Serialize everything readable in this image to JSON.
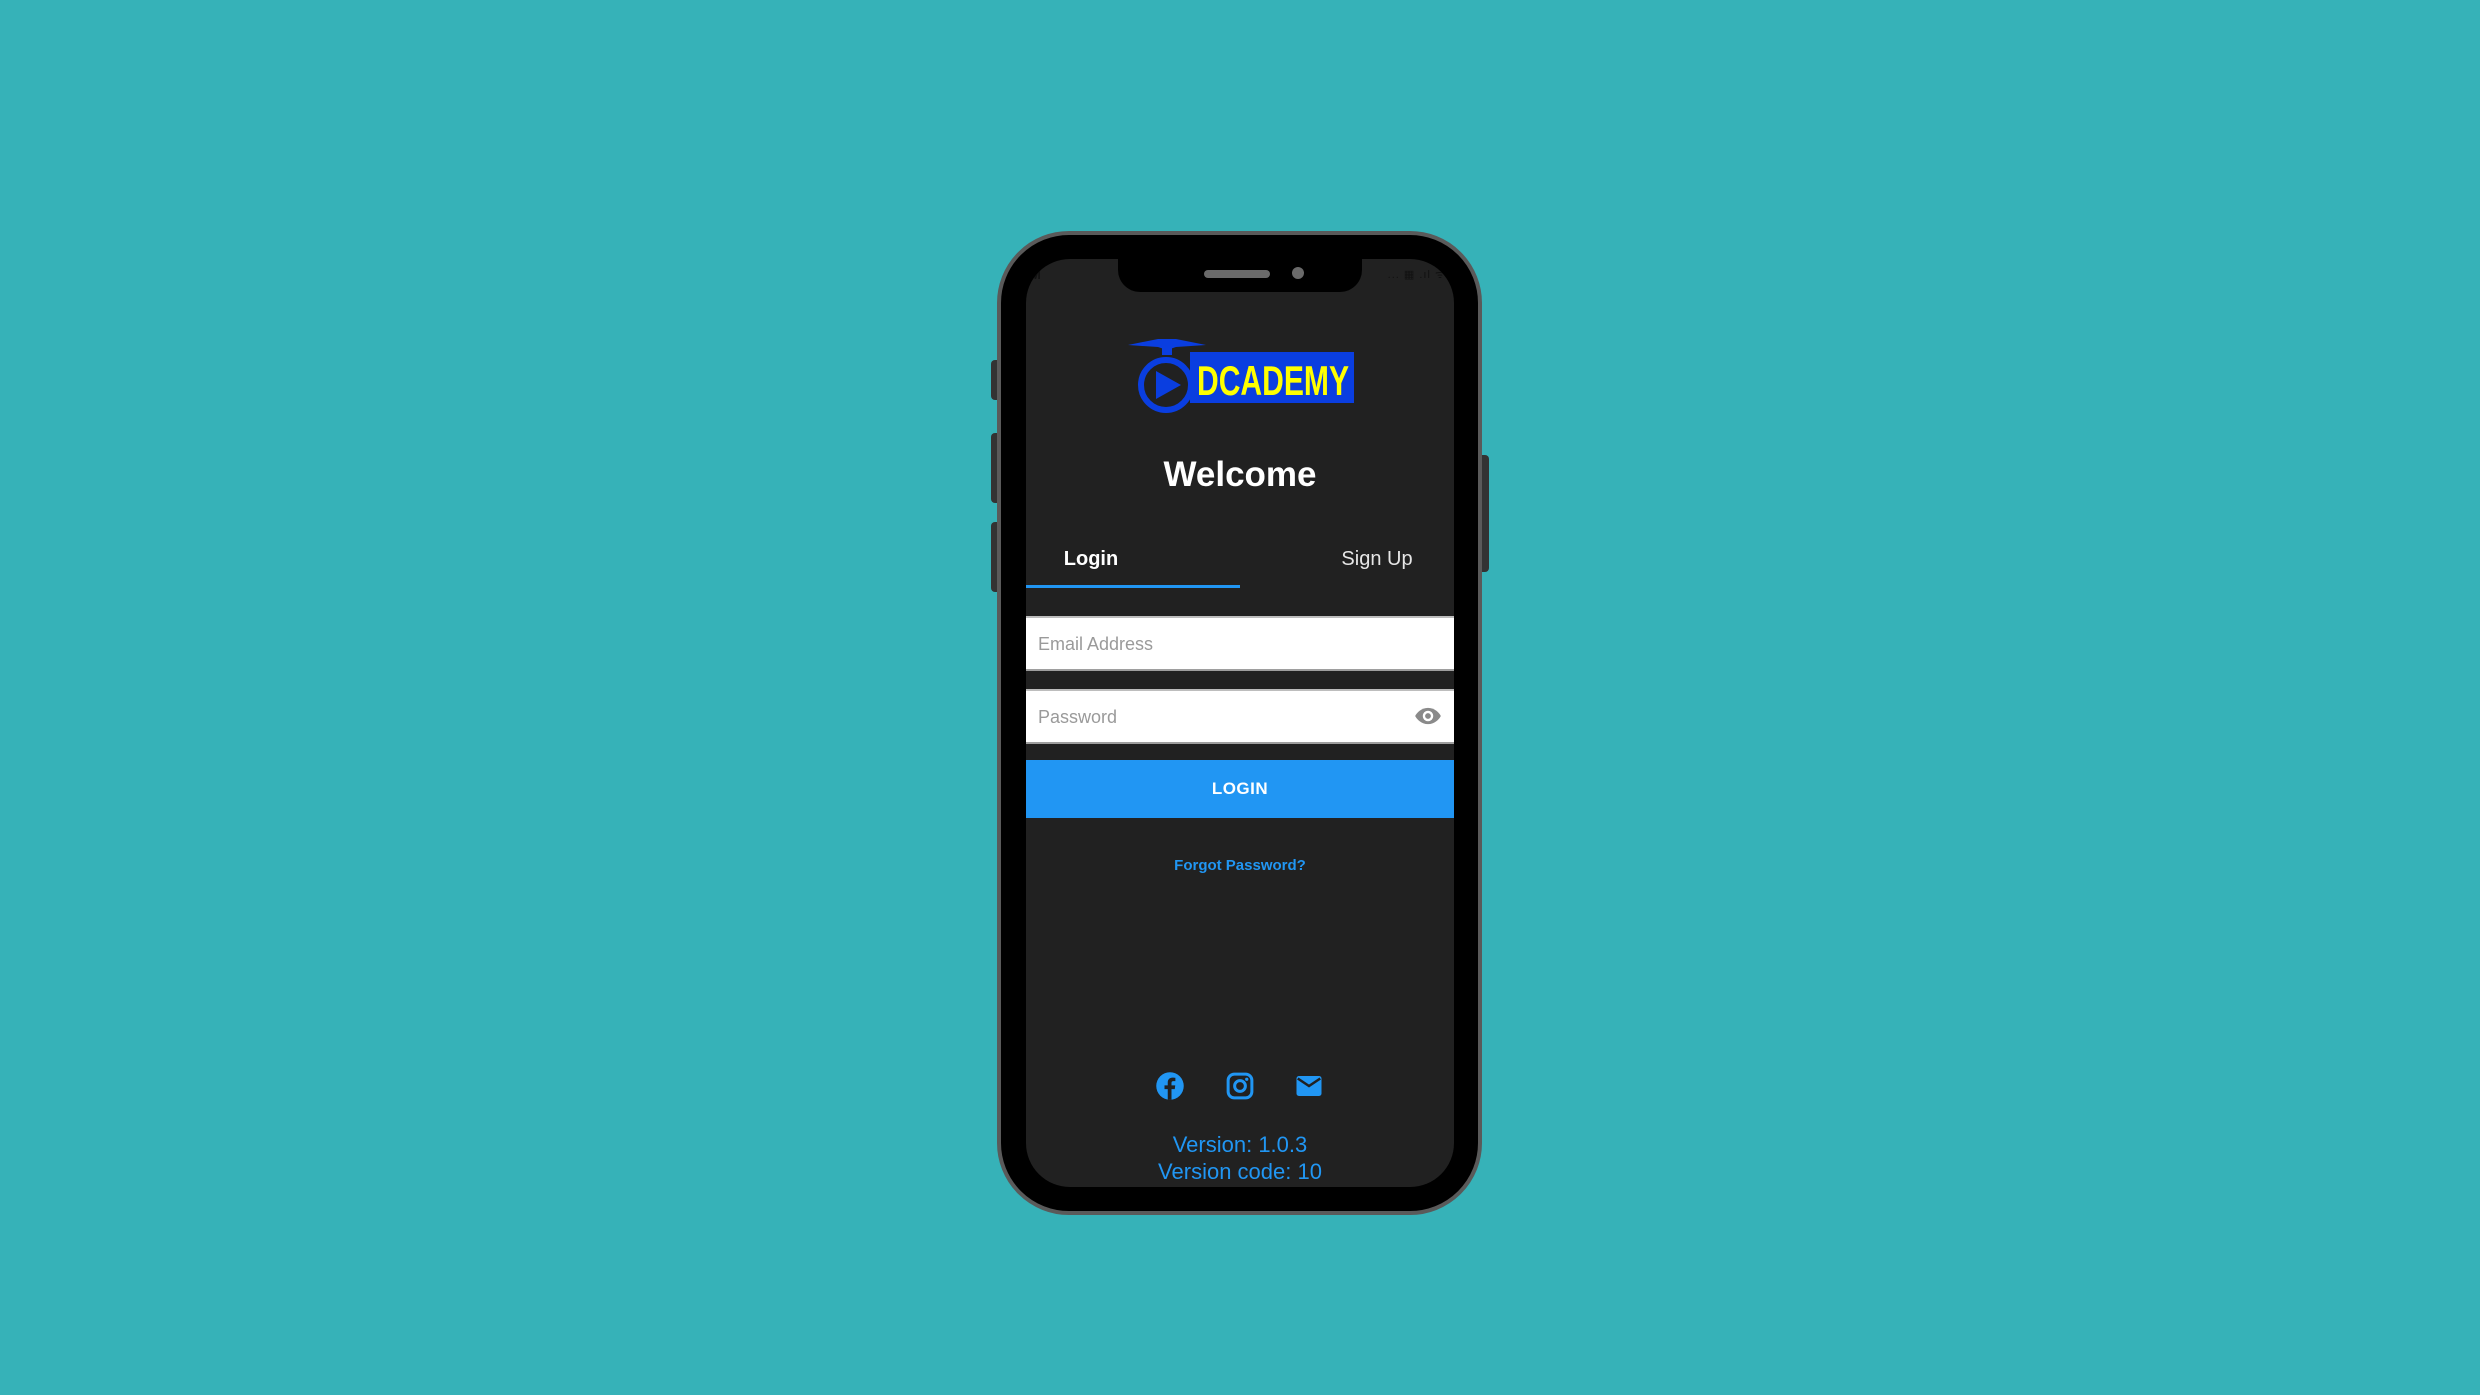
{
  "status_bar": {
    "left_text": "M",
    "right_text": "... ▦ .ıl ᯤ"
  },
  "app": {
    "logo_text": "DCADEMY",
    "welcome": "Welcome",
    "tabs": [
      {
        "label": "Login",
        "active": true
      },
      {
        "label": "Sign Up",
        "active": false
      }
    ],
    "form": {
      "email_placeholder": "Email Address",
      "email_value": "",
      "password_placeholder": "Password",
      "password_value": "",
      "password_toggle_icon": "eye-icon",
      "login_label": "LOGIN",
      "forgot_label": "Forgot Password?"
    },
    "socials": [
      {
        "name": "facebook",
        "icon": "facebook-icon"
      },
      {
        "name": "instagram",
        "icon": "instagram-icon"
      },
      {
        "name": "email",
        "icon": "mail-icon"
      }
    ],
    "version": "Version: 1.0.3",
    "version_code": "Version code: 10"
  },
  "colors": {
    "background": "#36b2b8",
    "screen": "#212121",
    "accent": "#2196f3",
    "logo_blue": "#0a3ee0",
    "logo_yellow": "#ffff00"
  }
}
